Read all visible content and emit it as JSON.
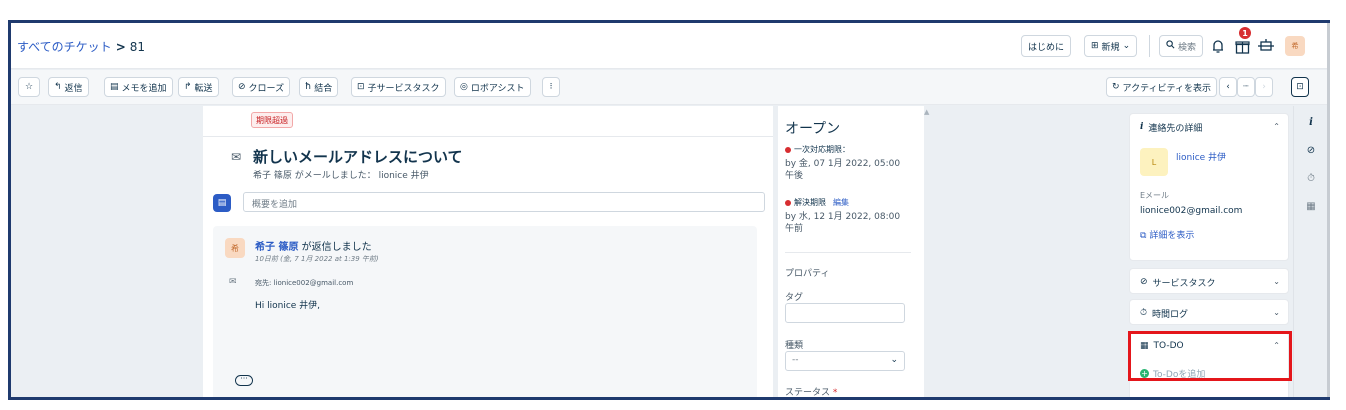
{
  "header": {
    "breadcrumb_all": "すべてのチケット",
    "breadcrumb_sep": ">",
    "ticket_id": "81",
    "getting_started": "はじめに",
    "new_button": "新規",
    "search_label": "検索",
    "notification_count": "1",
    "avatar_initial": "希"
  },
  "toolbar": {
    "reply": "返信",
    "add_note": "メモを追加",
    "forward": "転送",
    "close": "クローズ",
    "merge": "結合",
    "child_task": "子サービスタスク",
    "robo_assist": "ロボアシスト",
    "more": "⁝",
    "show_activity": "アクティビティを表示",
    "prev": "‹",
    "mid": "┈",
    "next": "›"
  },
  "ticket": {
    "overdue_badge": "期限超過",
    "subject": "新しいメールアドレスについて",
    "subline": "希子 篠原 がメールしました： lionice 井伊",
    "summary_placeholder": "概要を追加",
    "reply": {
      "avatar": "希",
      "author": "希子 篠原",
      "action": " が返信しました",
      "time": "10日前 (金, 7 1月 2022 at 1:39 午前)",
      "to": "宛先: lionice002@gmail.com",
      "body": "Hi lionice 井伊,"
    }
  },
  "status": {
    "title": "オープン",
    "first_response_label": "一次対応期限：",
    "first_response_value": "by 金, 07 1月 2022, 05:00 午後",
    "resolution_label": "解決期限",
    "resolution_edit": "編集",
    "resolution_value": "by 水, 12 1月 2022, 08:00 午前",
    "properties": "プロパティ",
    "tags": "タグ",
    "type": "種類",
    "type_value": "--",
    "status_label": "ステータス",
    "required": "*"
  },
  "contact": {
    "title": "連絡先の詳細",
    "avatar": "L",
    "name": "lionice 井伊",
    "email_label": "Eメール",
    "email": "lionice002@gmail.com",
    "show_details": "詳細を表示"
  },
  "panels": {
    "service_task": "サービスタスク",
    "time_log": "時間ログ",
    "todo": "TO-DO",
    "todo_add": "To-Doを追加"
  },
  "colors": {
    "accent": "#2c5cc5",
    "highlight": "#e4161b",
    "frame": "#1f3a6e",
    "badge": "#d72d30"
  }
}
